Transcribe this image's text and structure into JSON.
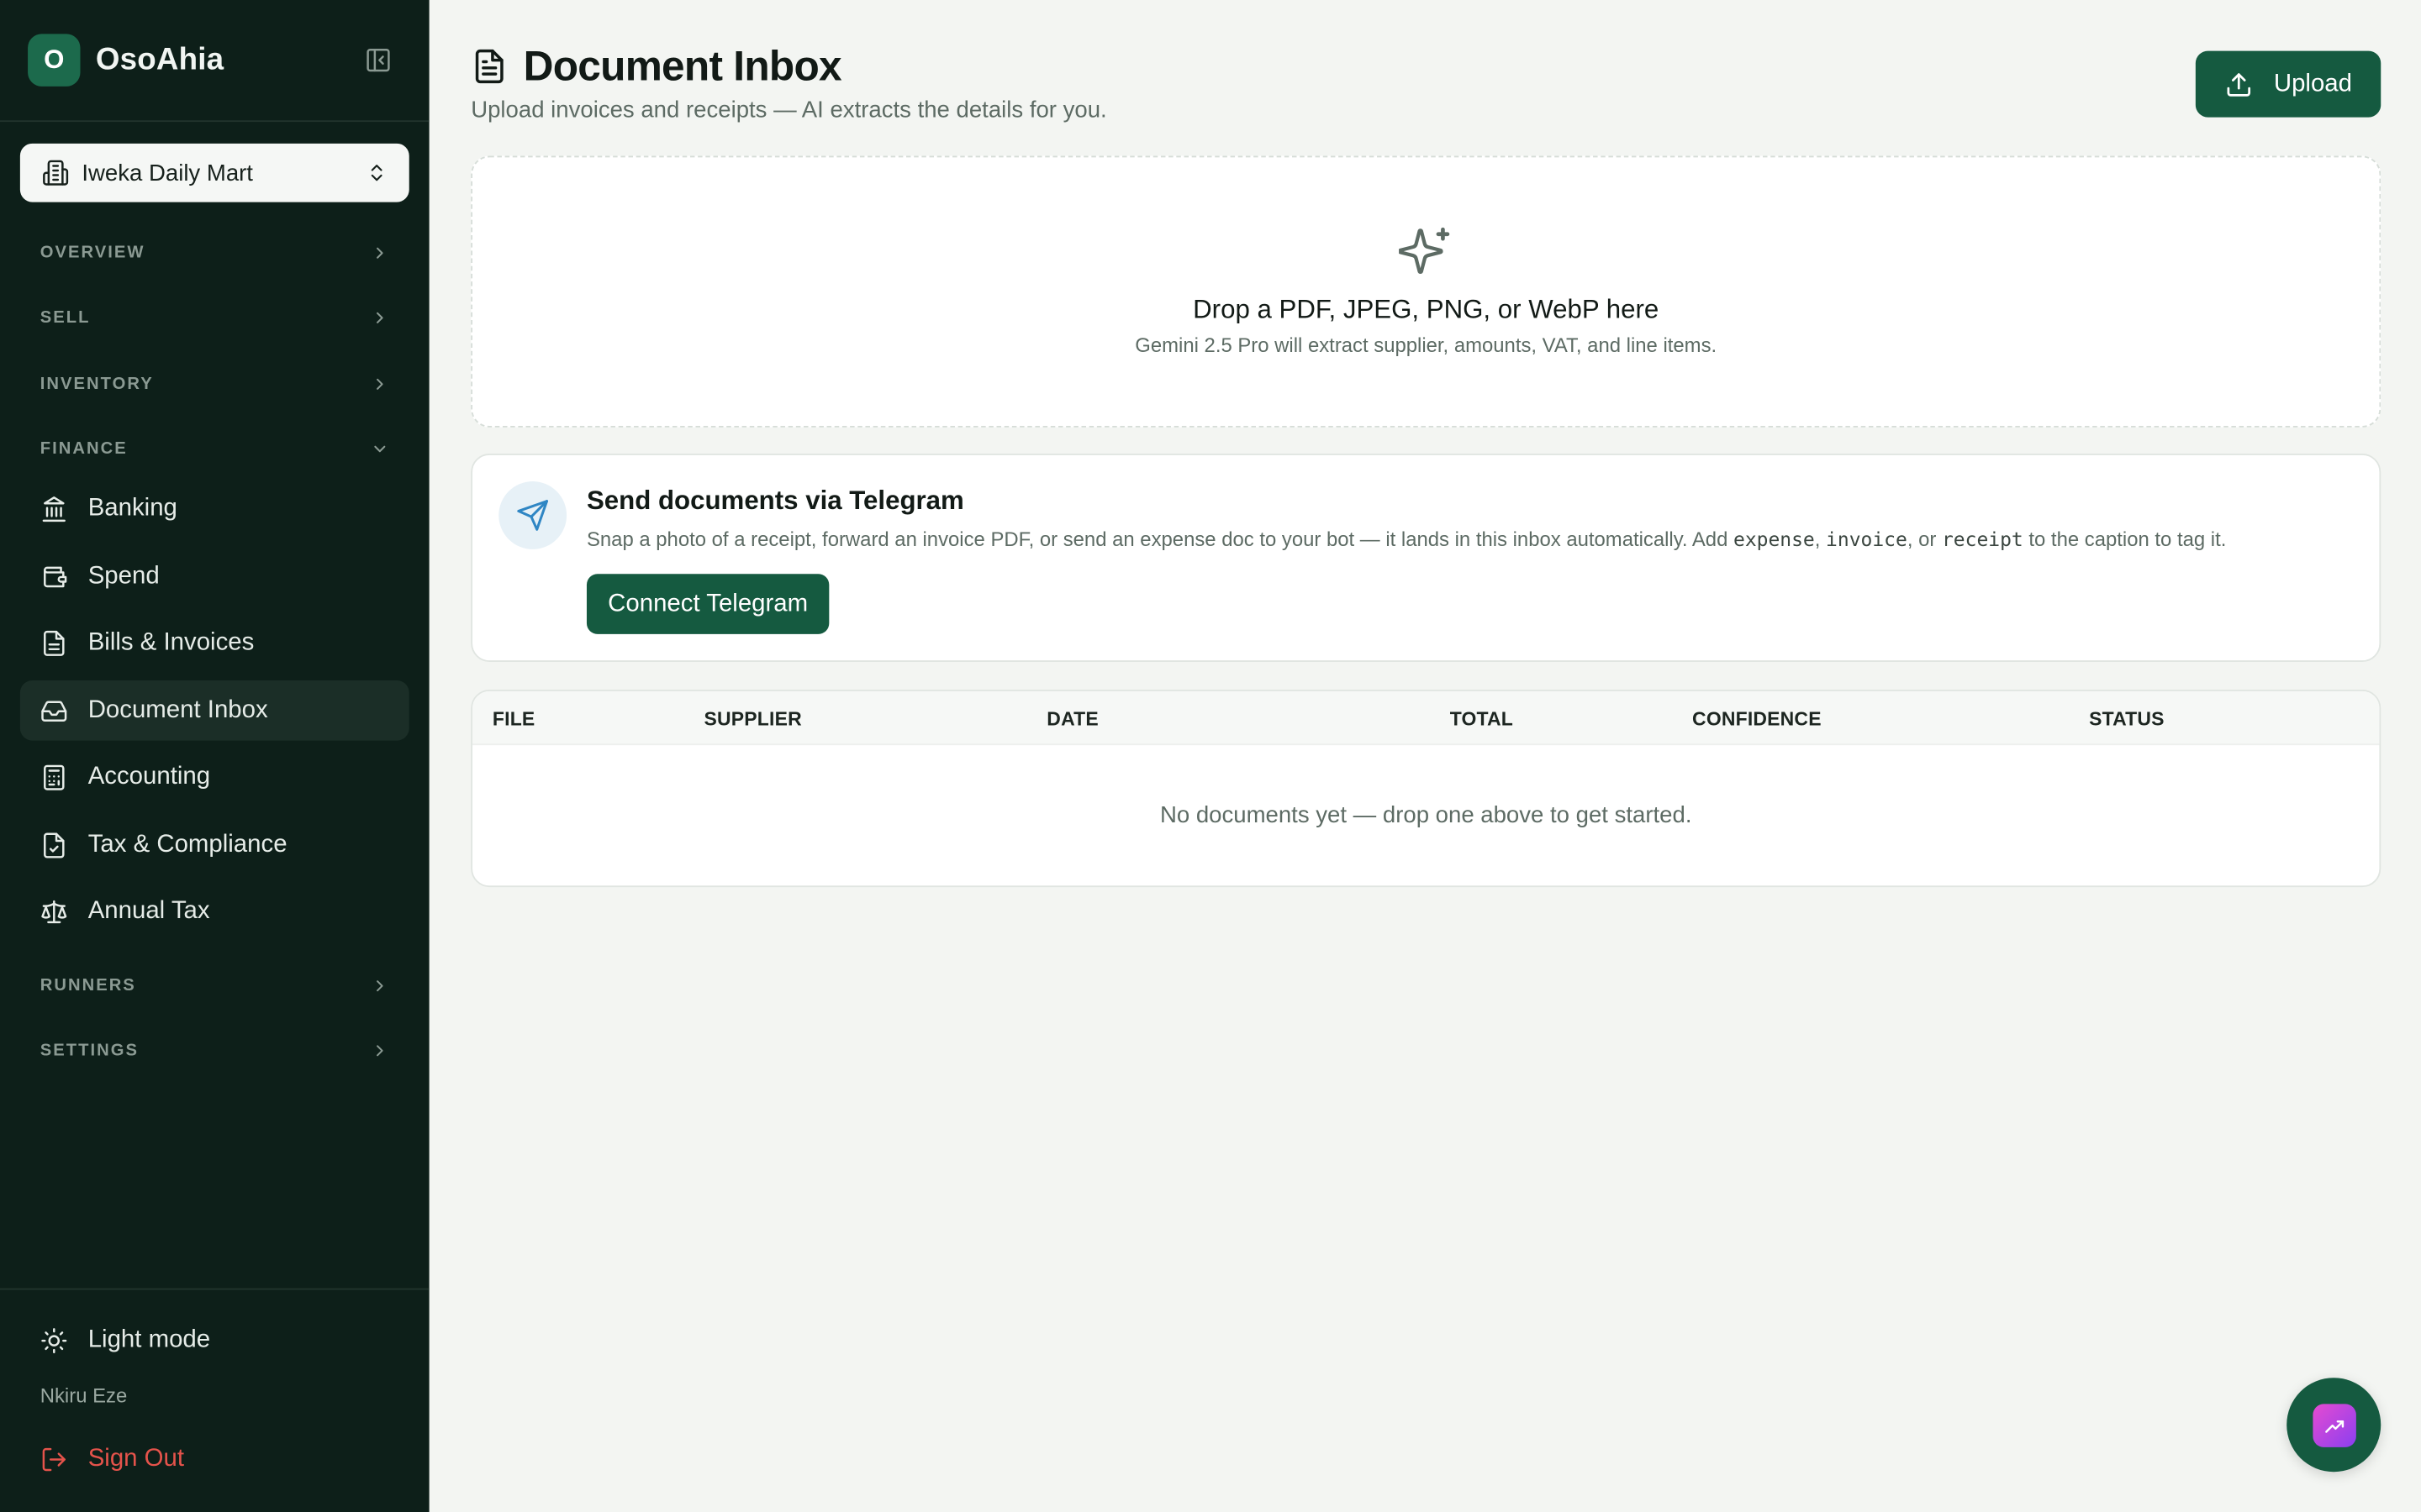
{
  "brand": {
    "logo_letter": "O",
    "name": "OsoAhia"
  },
  "store": {
    "name": "Iweka Daily Mart"
  },
  "sidebar": {
    "sections": [
      {
        "label": "OVERVIEW",
        "expanded": false
      },
      {
        "label": "SELL",
        "expanded": false
      },
      {
        "label": "INVENTORY",
        "expanded": false
      },
      {
        "label": "FINANCE",
        "expanded": true
      },
      {
        "label": "RUNNERS",
        "expanded": false
      },
      {
        "label": "SETTINGS",
        "expanded": false
      }
    ],
    "finance_items": [
      {
        "label": "Banking",
        "icon": "bank-icon"
      },
      {
        "label": "Spend",
        "icon": "wallet-icon"
      },
      {
        "label": "Bills & Invoices",
        "icon": "receipt-icon"
      },
      {
        "label": "Document Inbox",
        "icon": "inbox-icon",
        "active": true
      },
      {
        "label": "Accounting",
        "icon": "calculator-icon"
      },
      {
        "label": "Tax & Compliance",
        "icon": "file-check-icon"
      },
      {
        "label": "Annual Tax",
        "icon": "scale-icon"
      }
    ],
    "theme_toggle": "Light mode",
    "user_name": "Nkiru Eze",
    "sign_out": "Sign Out"
  },
  "page": {
    "title": "Document Inbox",
    "subtitle": "Upload invoices and receipts — AI extracts the details for you.",
    "upload_label": "Upload"
  },
  "dropzone": {
    "title": "Drop a PDF, JPEG, PNG, or WebP here",
    "subtitle": "Gemini 2.5 Pro will extract supplier, amounts, VAT, and line items."
  },
  "telegram": {
    "title": "Send documents via Telegram",
    "desc_1": "Snap a photo of a receipt, forward an invoice PDF, or send an expense doc to your bot — it lands in this inbox automatically. Add ",
    "code_1": "expense",
    "sep_1": ", ",
    "code_2": "invoice",
    "sep_2": ", or ",
    "code_3": "receipt",
    "desc_2": " to the caption to tag it.",
    "button": "Connect Telegram"
  },
  "table": {
    "columns": [
      "FILE",
      "SUPPLIER",
      "DATE",
      "TOTAL",
      "CONFIDENCE",
      "STATUS"
    ],
    "rows": [],
    "empty_message": "No documents yet — drop one above to get started."
  },
  "colors": {
    "sidebar_bg": "#0d1f19",
    "primary": "#155a40",
    "sign_out": "#e5534b",
    "page_bg": "#f3f5f2"
  }
}
